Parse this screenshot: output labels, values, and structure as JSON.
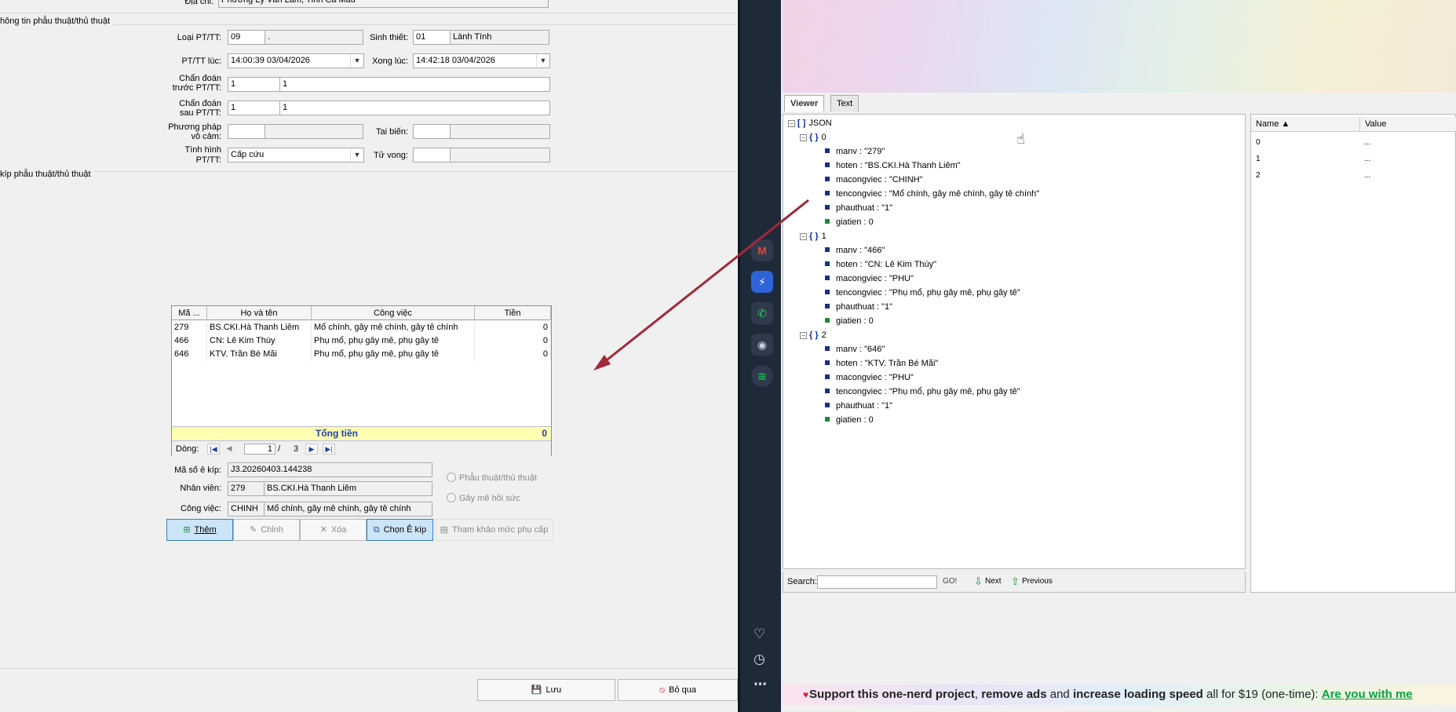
{
  "form": {
    "address_label": "Địa chỉ:",
    "address_value": "Phường Lý Văn Lâm, Tỉnh Cà Mau",
    "section1_title": "hông tin phẫu thuật/thủ thuật",
    "loai_label": "Loại PT/TT:",
    "loai_code": "09",
    "loai_name": ".",
    "sinhthiet_label": "Sinh thiết:",
    "sinhthiet_code": "01",
    "sinhthiet_name": "Lành Tính",
    "ptttluc_label": "PT/TT lúc:",
    "ptttluc_value": "14:00:39 03/04/2026",
    "xongluc_label": "Xong lúc:",
    "xongluc_value": "14:42:18 03/04/2026",
    "cd_truoc_label_1": "Chẩn đoán",
    "cd_truoc_label_2": "trước PT/TT:",
    "cd_truoc_code": "1",
    "cd_truoc_name": "1",
    "cd_sau_label_1": "Chẩn đoán",
    "cd_sau_label_2": "sau PT/TT:",
    "cd_sau_code": "1",
    "cd_sau_name": "1",
    "pp_label_1": "Phương pháp",
    "pp_label_2": "vô cảm:",
    "taibien_label": "Tai biến:",
    "tinhhinh_label_1": "Tình hình",
    "tinhhinh_label_2": "PT/TT:",
    "tinhhinh_value": "Cấp cứu",
    "tuvong_label": "Tử vong:",
    "section2_title": "kíp phẫu thuật/thủ thuật"
  },
  "grid": {
    "headers": [
      "Mã ...",
      "Họ và tên",
      "Công việc",
      "Tiền"
    ],
    "rows": [
      {
        "ma": "279",
        "ten": "BS.CKI.Hà Thanh Liêm",
        "cv": "Mổ chính, gây mê chính, gây tê chính",
        "tien": "0"
      },
      {
        "ma": "466",
        "ten": "CN: Lê Kim Thúy",
        "cv": "Phụ mổ, phụ gây mê, phụ gây tê",
        "tien": "0"
      },
      {
        "ma": "646",
        "ten": "KTV. Trần Bé Mãi",
        "cv": "Phụ mổ, phụ gây mê, phụ gây tê",
        "tien": "0"
      }
    ],
    "total_label": "Tổng tiền",
    "total_value": "0",
    "nav_label": "Dòng:",
    "nav_current": "1",
    "nav_sep": "/",
    "nav_total": "3"
  },
  "ekip": {
    "maso_label": "Mã số ê kíp:",
    "maso_value": "J3.20260403.144238",
    "nhanvien_label": "Nhân viên:",
    "nhanvien_code": "279",
    "nhanvien_name": "BS.CKI.Hà Thanh Liêm",
    "congviec_label": "Công việc:",
    "congviec_code": "CHINH",
    "congviec_name": "Mổ chính, gây mê chính, gây tê chính",
    "radio1": "Phẫu thuật/thủ thuật",
    "radio2": "Gây mê hồi sức"
  },
  "buttons": {
    "them": "Thêm",
    "chinh": "Chỉnh",
    "xoa": "Xóa",
    "chon": "Chọn Ê kíp",
    "thamkhao": "Tham khảo mức phụ cấp",
    "luu": "Lưu",
    "boqua": "Bỏ qua"
  },
  "viewer": {
    "tab_viewer": "Viewer",
    "tab_text": "Text",
    "root": "JSON",
    "nodes": [
      {
        "index": "0",
        "props": [
          [
            "manv",
            "\"279\""
          ],
          [
            "hoten",
            "\"BS.CKI.Hà Thanh Liêm\""
          ],
          [
            "macongviec",
            "\"CHINH\""
          ],
          [
            "tencongviec",
            "\"Mổ chính, gây mê chính, gây tê chính\""
          ],
          [
            "phauthuat",
            "\"1\""
          ],
          [
            "giatien",
            "0"
          ]
        ]
      },
      {
        "index": "1",
        "props": [
          [
            "manv",
            "\"466\""
          ],
          [
            "hoten",
            "\"CN: Lê Kim Thúy\""
          ],
          [
            "macongviec",
            "\"PHU\""
          ],
          [
            "tencongviec",
            "\"Phụ mổ, phụ gây mê, phụ gây tê\""
          ],
          [
            "phauthuat",
            "\"1\""
          ],
          [
            "giatien",
            "0"
          ]
        ]
      },
      {
        "index": "2",
        "props": [
          [
            "manv",
            "\"646\""
          ],
          [
            "hoten",
            "\"KTV. Trần Bé Mãi\""
          ],
          [
            "macongviec",
            "\"PHU\""
          ],
          [
            "tencongviec",
            "\"Phụ mổ, phụ gây mê, phụ gây tê\""
          ],
          [
            "phauthuat",
            "\"1\""
          ],
          [
            "giatien",
            "0"
          ]
        ]
      }
    ],
    "prop_col_name": "Name ▲",
    "prop_col_value": "Value",
    "prop_rows": [
      [
        "0",
        "..."
      ],
      [
        "1",
        "..."
      ],
      [
        "2",
        "..."
      ]
    ],
    "search_label": "Search:",
    "go_label": "GO!",
    "next_label": "Next",
    "prev_label": "Previous"
  },
  "ad": {
    "part1": "Support this one-nerd project",
    "part2": ", ",
    "part3": "remove ads",
    "part4": " and ",
    "part5": "increase loading speed",
    "part6": " all for $19 (one-time): ",
    "link": "Are you with me"
  },
  "colors": {
    "sidebar_bg": "#1f2a38",
    "arrow": "#a0283a",
    "accent_blue": "#1d3fb3",
    "total_bg": "#ffffb0"
  },
  "icons": [
    "gmail-icon",
    "messenger-icon",
    "whatsapp-icon",
    "discord-icon",
    "spotify-icon",
    "heart-icon",
    "clock-icon",
    "more-icon"
  ]
}
